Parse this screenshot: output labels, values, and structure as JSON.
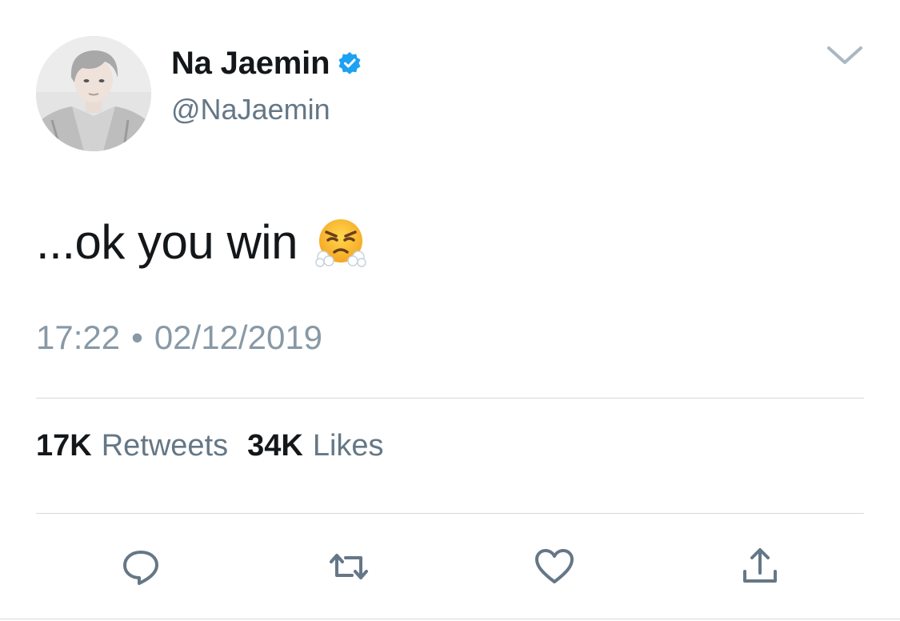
{
  "user": {
    "display_name": "Na Jaemin",
    "handle": "@NaJaemin",
    "verified": true
  },
  "tweet": {
    "text": "...ok you win",
    "emoji": "face-with-steam-from-nose",
    "time": "17:22",
    "separator": "•",
    "date": "02/12/2019"
  },
  "stats": {
    "retweets_count": "17K",
    "retweets_label": "Retweets",
    "likes_count": "34K",
    "likes_label": "Likes"
  },
  "actions": [
    "reply-icon",
    "retweet-icon",
    "like-icon",
    "share-icon"
  ],
  "colors": {
    "text_primary": "#14171a",
    "text_secondary": "#657786",
    "timestamp": "#8899a6",
    "verified_blue": "#1da1f2",
    "icon_gray": "#657786",
    "divider": "#d6d9dc"
  }
}
